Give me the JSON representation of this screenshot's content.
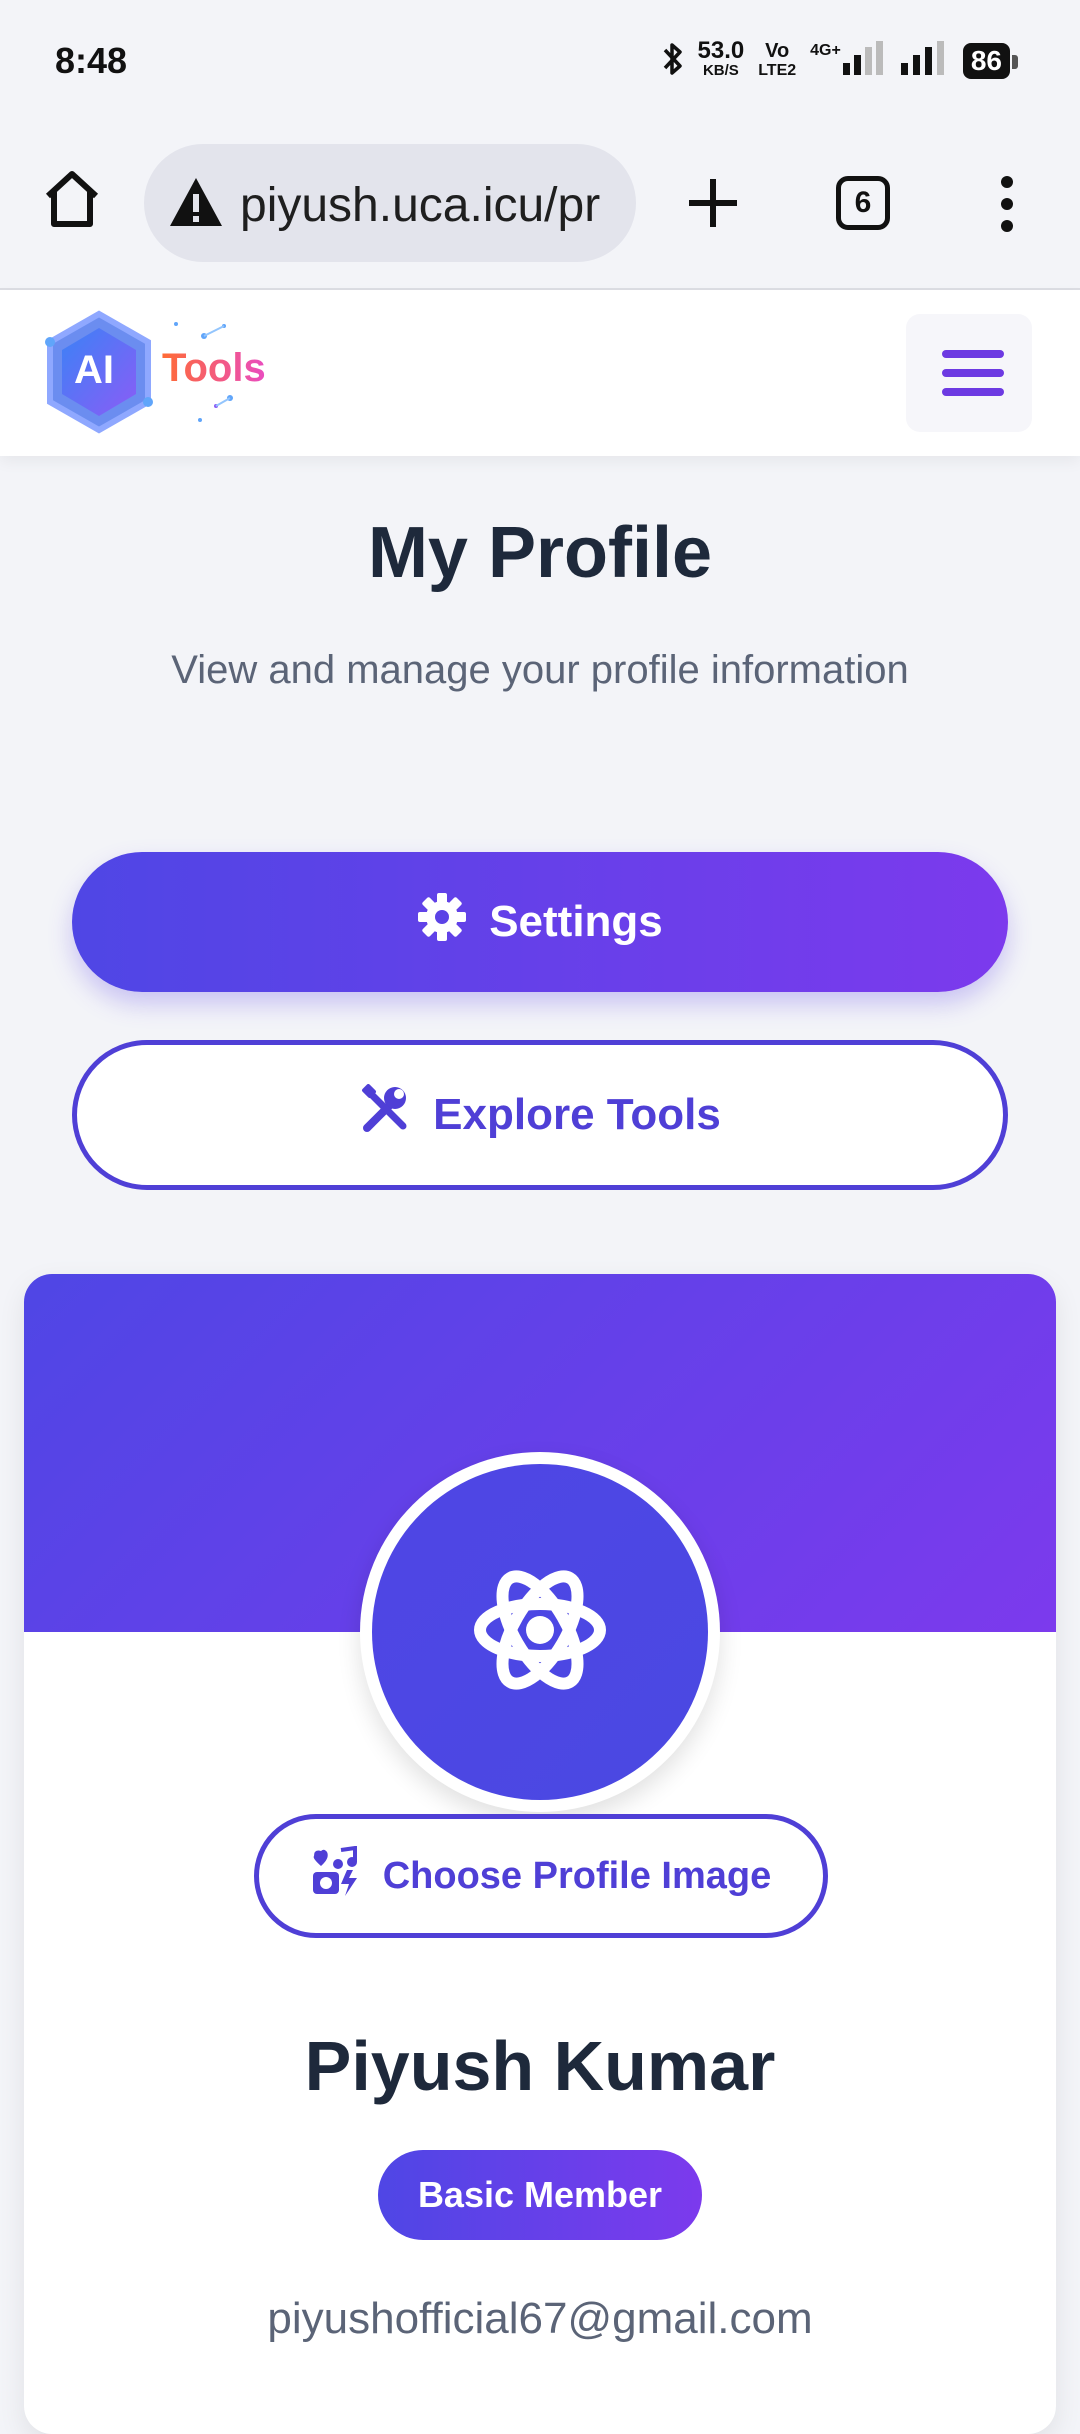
{
  "status_bar": {
    "time": "8:48",
    "speed_value": "53.0",
    "speed_unit": "KB/S",
    "volte_top": "Vo",
    "volte_bottom": "LTE2",
    "network": "4G+",
    "battery": "86",
    "icons": [
      "bluetooth-icon",
      "signal-icon",
      "signal-icon",
      "battery-icon"
    ]
  },
  "browser": {
    "url": "piyush.uca.icu/pr",
    "tab_count": "6",
    "icons": [
      "home-icon",
      "warning-icon",
      "plus-icon",
      "tabs-icon",
      "more-icon"
    ]
  },
  "header": {
    "logo_ai": "AI",
    "logo_tools": "Tools",
    "menu_icon": "hamburger-icon"
  },
  "page": {
    "title": "My Profile",
    "subtitle": "View and manage your profile information",
    "settings_label": "Settings",
    "explore_label": "Explore Tools"
  },
  "profile": {
    "choose_image_label": "Choose Profile Image",
    "name": "Piyush Kumar",
    "membership": "Basic Member",
    "email": "piyushofficial67@gmail.com"
  },
  "colors": {
    "accent": "#4f46e5",
    "accent_end": "#7c3aed",
    "outline": "#4f3fd6",
    "title": "#1e293b",
    "muted": "#5b6477"
  }
}
